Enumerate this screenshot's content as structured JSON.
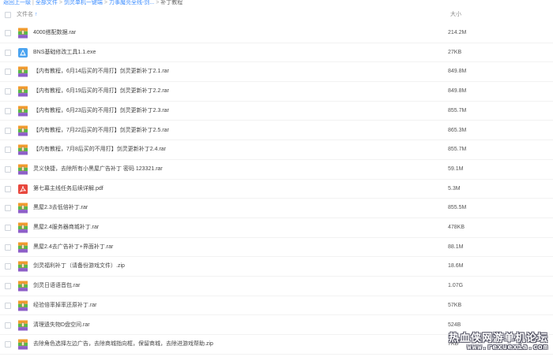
{
  "breadcrumb": {
    "items": [
      "返回上一级",
      "全部文件",
      "剑灵单机一键端",
      "力事魔亮全线-剑...",
      "补丁教程"
    ],
    "separators": [
      "|",
      ">",
      ">",
      ">"
    ]
  },
  "header": {
    "name_label": "文件名",
    "sort_icon": "↑",
    "size_label": "大小"
  },
  "files": [
    {
      "name": "4000搭配数据.rar",
      "size": "214.2M",
      "icon": "rar-archive-icon"
    },
    {
      "name": "BNS基础修改工具1.1.exe",
      "size": "27KB",
      "icon": "exe-app-icon"
    },
    {
      "name": "【内有教程，6月14后买的不用打】剑灵更新补丁2.1.rar",
      "size": "849.8M",
      "icon": "rar-archive-icon"
    },
    {
      "name": "【内有教程，6月19后买的不用打】剑灵更新补丁2.2.rar",
      "size": "849.8M",
      "icon": "rar-archive-icon"
    },
    {
      "name": "【内有教程，6月23后买的不用打】剑灵更新补丁2.3.rar",
      "size": "855.7M",
      "icon": "rar-archive-icon"
    },
    {
      "name": "【内有教程，7月22后买的不用打】剑灵更新补丁2.5.rar",
      "size": "865.3M",
      "icon": "rar-archive-icon"
    },
    {
      "name": "【内有教程，7月8后买的不用打】剑灵更新补丁2.4.rar",
      "size": "855.7M",
      "icon": "rar-archive-icon"
    },
    {
      "name": "灵义快捷，去除所有小黑屋广告补丁 密码 123321.rar",
      "size": "59.1M",
      "icon": "rar-archive-icon"
    },
    {
      "name": "第七幕主线任务后续详解.pdf",
      "size": "5.3M",
      "icon": "pdf-document-icon"
    },
    {
      "name": "黑屋2.3去低倍补丁.rar",
      "size": "855.5M",
      "icon": "rar-archive-icon"
    },
    {
      "name": "黑屋2.4服务器商城补丁.rar",
      "size": "478KB",
      "icon": "rar-archive-icon"
    },
    {
      "name": "黑屋2.4去广告补丁+界面补丁.rar",
      "size": "88.1M",
      "icon": "rar-archive-icon"
    },
    {
      "name": "剑灵福利补丁（请备份游戏文件）.zip",
      "size": "18.6M",
      "icon": "zip-archive-icon"
    },
    {
      "name": "剑灵日语语音包.rar",
      "size": "1.07G",
      "icon": "rar-archive-icon"
    },
    {
      "name": "经验倍率掉率还原补丁.rar",
      "size": "57KB",
      "icon": "rar-archive-icon"
    },
    {
      "name": "清理遗失物D盘空间.rar",
      "size": "524B",
      "icon": "rar-archive-icon"
    },
    {
      "name": "去除角色选择左边广告，去除商城指向框，保留商城，去除进游戏帮助.zip",
      "size": "7KB",
      "icon": "zip-archive-icon"
    }
  ],
  "watermark": {
    "line1": "热血侠网游单机论坛",
    "line2": "www.rexuexia.com"
  },
  "colors": {
    "accent": "#3b8cff",
    "rar_orange": "#f29b2e",
    "rar_green": "#59b84a",
    "rar_purple": "#8d5fc8",
    "exe_blue": "#4aa3f0",
    "pdf_red": "#e8473d"
  }
}
